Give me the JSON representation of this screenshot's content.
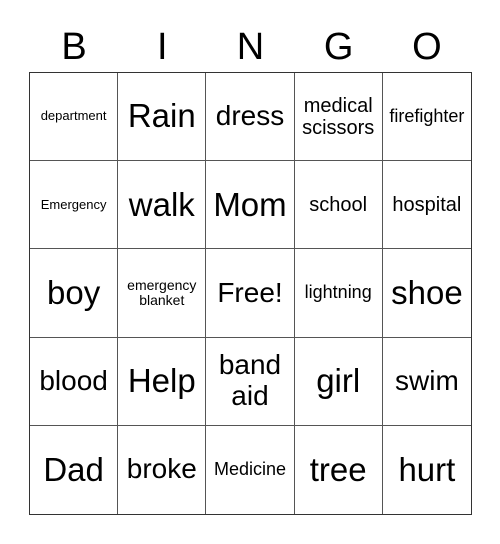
{
  "header": [
    "B",
    "I",
    "N",
    "G",
    "O"
  ],
  "cells": [
    "department",
    "Rain",
    "dress",
    "medical scissors",
    "firefighter",
    "Emergency",
    "walk",
    "Mom",
    "school",
    "hospital",
    "boy",
    "emergency blanket",
    "Free!",
    "lightning",
    "shoe",
    "blood",
    "Help",
    "band aid",
    "girl",
    "swim",
    "Dad",
    "broke",
    "Medicine",
    "tree",
    "hurt"
  ]
}
